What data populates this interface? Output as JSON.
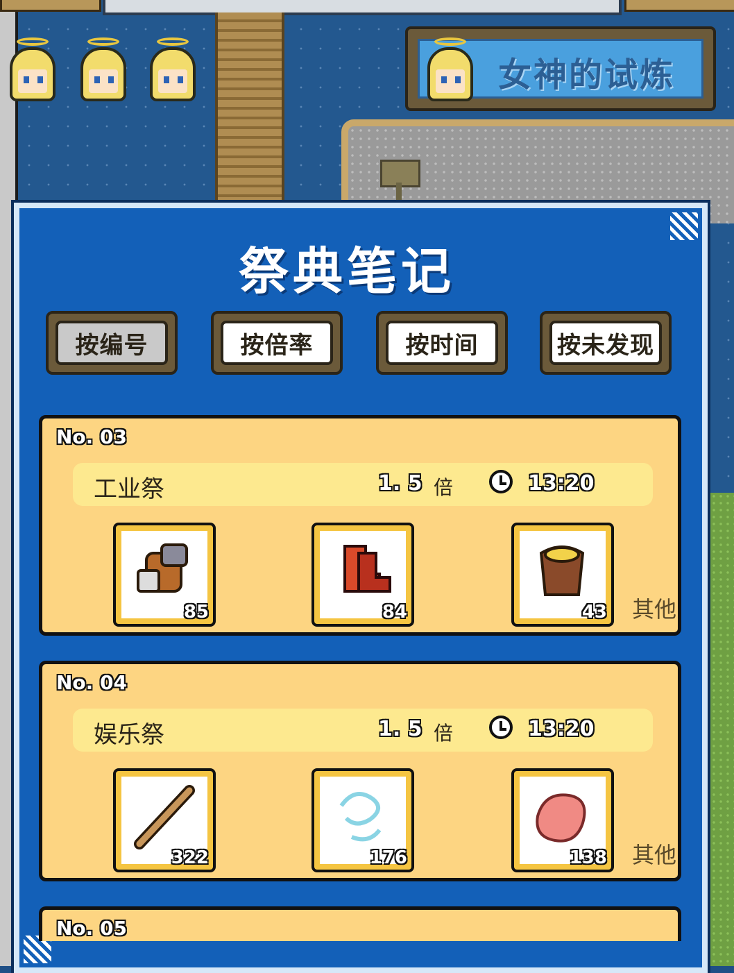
{
  "trial": {
    "label": "女神的试炼"
  },
  "panel": {
    "title": "祭典笔记"
  },
  "sort_buttons": [
    {
      "label": "按编号",
      "active": true
    },
    {
      "label": "按倍率",
      "active": false
    },
    {
      "label": "按时间",
      "active": false
    },
    {
      "label": "按未发现",
      "active": false
    }
  ],
  "festivals": [
    {
      "number": "No. 03",
      "name": "工业祭",
      "rate": "1. 5",
      "rate_unit": "倍",
      "time": "13:20",
      "items": [
        {
          "icon": "glove-icon",
          "count": "85"
        },
        {
          "icon": "boots-icon",
          "count": "84"
        },
        {
          "icon": "armor-icon",
          "count": "43"
        }
      ],
      "other_label": "其他"
    },
    {
      "number": "No. 04",
      "name": "娱乐祭",
      "rate": "1. 5",
      "rate_unit": "倍",
      "time": "13:20",
      "items": [
        {
          "icon": "wooden-stick-icon",
          "count": "322"
        },
        {
          "icon": "wind-swirl-icon",
          "count": "176"
        },
        {
          "icon": "pink-cloth-icon",
          "count": "138"
        }
      ],
      "other_label": "其他"
    },
    {
      "number": "No. 05"
    }
  ],
  "colors": {
    "panel": "#1360b8",
    "card": "#fdd582",
    "card_info": "#fde98f",
    "slot_frame": "#f5c542",
    "trial_button": "#4aa0de"
  }
}
